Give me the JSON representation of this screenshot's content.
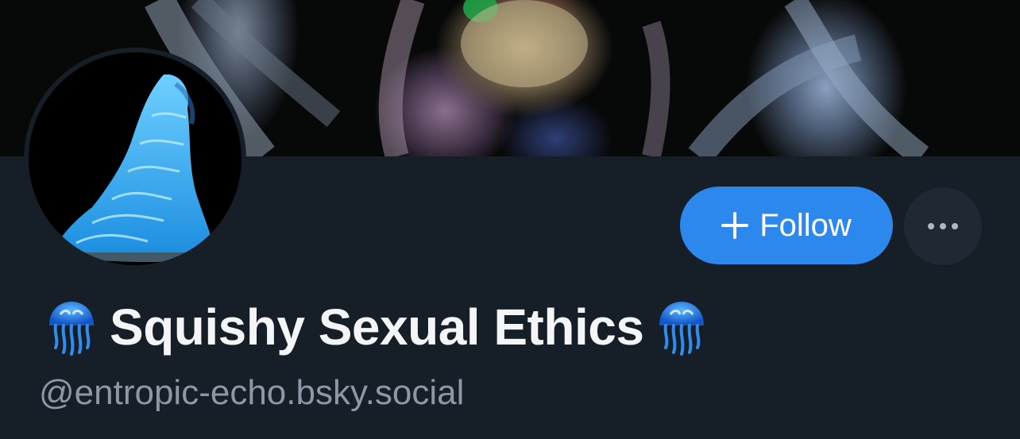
{
  "profile": {
    "display_name": "Squishy Sexual Ethics",
    "name_prefix_emoji": "jellyfish-emoji",
    "name_suffix_emoji": "jellyfish-emoji",
    "handle": "@entropic-echo.bsky.social"
  },
  "actions": {
    "follow_label": "Follow",
    "follow_icon": "plus-icon",
    "more_icon": "ellipsis-icon"
  },
  "colors": {
    "background": "#161e27",
    "accent": "#2c88ed",
    "more_button_bg": "#1f2934",
    "name_text": "#f3f5f7",
    "handle_text": "#8c98a6"
  }
}
